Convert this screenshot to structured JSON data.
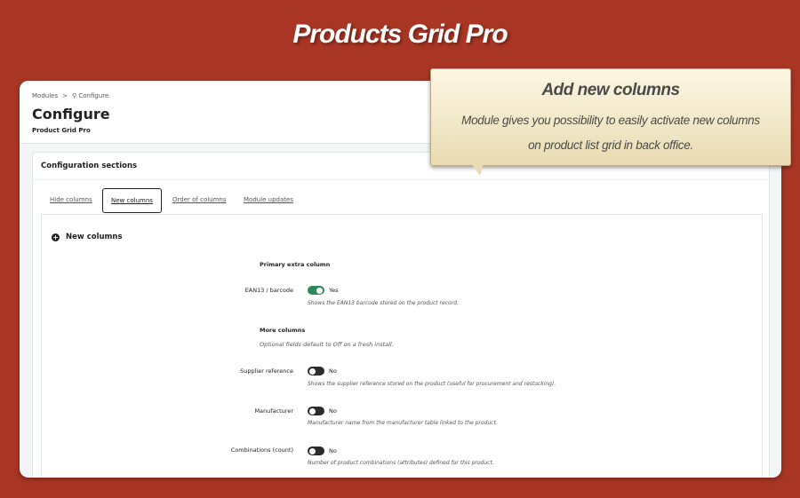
{
  "banner": {
    "title": "Products Grid Pro"
  },
  "callout": {
    "title": "Add new columns",
    "line1": "Module gives you possibility to easily activate  new columns",
    "line2": "on product list grid in back office."
  },
  "breadcrumb": {
    "parent": "Modules",
    "separator": ">",
    "current": "Configure"
  },
  "header": {
    "title": "Configure",
    "subtitle": "Product Grid Pro"
  },
  "card": {
    "title": "Configuration sections"
  },
  "tabs": [
    {
      "label": "Hide columns",
      "active": false
    },
    {
      "label": "New columns",
      "active": true
    },
    {
      "label": "Order of columns",
      "active": false
    },
    {
      "label": "Module updates",
      "active": false
    }
  ],
  "section": {
    "title": "New columns"
  },
  "groups": {
    "primary": {
      "title": "Primary extra column"
    },
    "more": {
      "title": "More columns",
      "help": "Optional fields default to Off on a fresh install."
    }
  },
  "fields": [
    {
      "label": "EAN13 / barcode",
      "enabled": true,
      "state_text": "Yes",
      "help": "Shows the EAN13 barcode stored on the product record."
    },
    {
      "label": "Supplier reference",
      "enabled": false,
      "state_text": "No",
      "help": "Shows the supplier reference stored on the product (useful for procurement and restocking)."
    },
    {
      "label": "Manufacturer",
      "enabled": false,
      "state_text": "No",
      "help": "Manufacturer name from the manufacturer table linked to the product."
    },
    {
      "label": "Combinations (count)",
      "enabled": false,
      "state_text": "No",
      "help": "Number of product combinations (attributes) defined for this product."
    }
  ],
  "colors": {
    "background": "#a93524",
    "toggle_on": "#2e8b57",
    "toggle_off": "#2b2b2b"
  },
  "icons": {
    "section": "plus-circle-icon",
    "breadcrumb": "wrench-icon"
  }
}
